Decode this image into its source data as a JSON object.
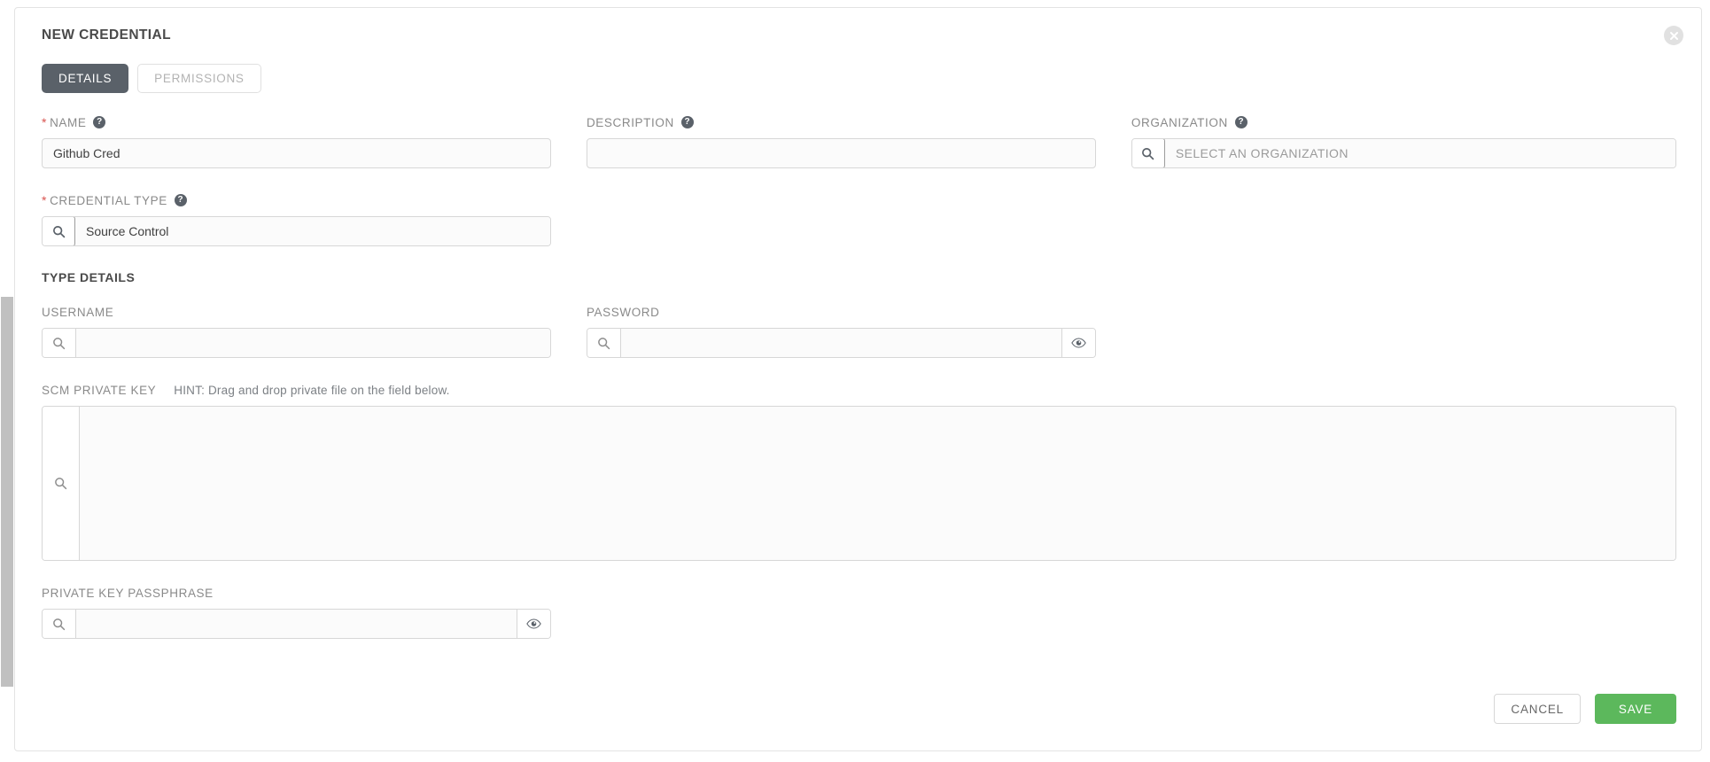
{
  "window": {
    "title": "NEW CREDENTIAL",
    "close_icon": "close-circle-icon"
  },
  "tabs": [
    {
      "label": "DETAILS",
      "active": true
    },
    {
      "label": "PERMISSIONS",
      "active": false
    }
  ],
  "fields": {
    "name": {
      "label": "NAME",
      "required": true,
      "help": "?",
      "value": "Github Cred",
      "placeholder": ""
    },
    "description": {
      "label": "DESCRIPTION",
      "required": false,
      "help": "?",
      "value": "",
      "placeholder": ""
    },
    "organization": {
      "label": "ORGANIZATION",
      "required": false,
      "help": "?",
      "value": "",
      "placeholder": "SELECT AN ORGANIZATION",
      "lookup_icon": "search-icon"
    },
    "credential_type": {
      "label": "CREDENTIAL TYPE",
      "required": true,
      "help": "?",
      "value": "Source Control",
      "placeholder": "",
      "lookup_icon": "search-icon"
    },
    "username": {
      "label": "USERNAME",
      "value": "",
      "placeholder": "",
      "lookup_icon": "search-icon"
    },
    "password": {
      "label": "PASSWORD",
      "value": "",
      "placeholder": "",
      "lookup_icon": "search-icon",
      "reveal_icon": "eye-icon"
    },
    "scm_private_key": {
      "label": "SCM PRIVATE KEY",
      "hint": "HINT: Drag and drop private file on the field below.",
      "value": "",
      "placeholder": "",
      "lookup_icon": "search-icon"
    },
    "private_key_passphrase": {
      "label": "PRIVATE KEY PASSPHRASE",
      "value": "",
      "placeholder": "",
      "lookup_icon": "search-icon",
      "reveal_icon": "eye-icon"
    }
  },
  "sections": {
    "type_details": "TYPE DETAILS"
  },
  "footer": {
    "cancel_label": "CANCEL",
    "save_label": "SAVE"
  },
  "colors": {
    "tab_active_bg": "#5a6169",
    "save_bg": "#5cb85c",
    "required_star": "#d9534f",
    "label_text": "#8a8a8a",
    "border": "#d7d7d7"
  }
}
